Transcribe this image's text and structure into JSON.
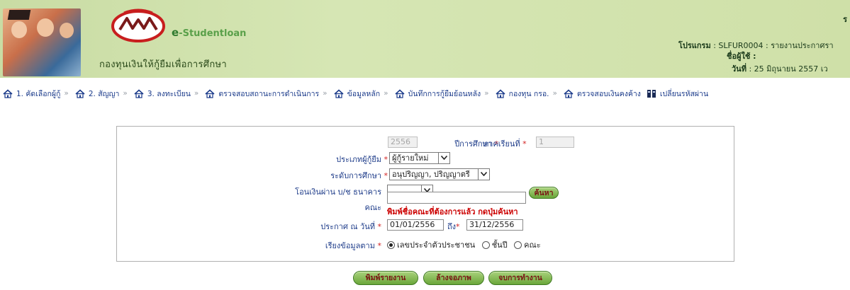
{
  "header": {
    "brand": "Studentloan",
    "brand_prefix": "e",
    "fund_name": "กองทุนเงินให้กู้ยืมเพื่อการศึกษา",
    "corner_text": "ร",
    "program_label": "โปรแกรม",
    "program_value": ": SLFUR0004 : รายงานประกาศรา",
    "user_label": "ชื่อผู้ใช้ :",
    "date_label": "วันที่",
    "date_value": ": 25 มิถุนายน 2557 เว"
  },
  "menu": {
    "items": [
      {
        "label": "1. คัดเลือกผู้กู้",
        "icon": "home-icon"
      },
      {
        "label": "2. สัญญา",
        "icon": "home-icon"
      },
      {
        "label": "3. ลงทะเบียน",
        "icon": "home-icon"
      },
      {
        "label": "ตรวจสอบสถานะการดำเนินการ",
        "icon": "home-icon"
      },
      {
        "label": "ข้อมูลหลัก",
        "icon": "home-icon"
      },
      {
        "label": "บันทึกการกู้ยืมย้อนหลัง",
        "icon": "home-icon"
      },
      {
        "label": "กองทุน กรอ.",
        "icon": "home-icon"
      },
      {
        "label": "ตรวจสอบเงินคงค้าง",
        "icon": "home-icon"
      },
      {
        "label": "เปลี่ยนรหัสผ่าน",
        "icon": "key-icon"
      }
    ],
    "separator": "»"
  },
  "form": {
    "academic_year": {
      "label": "ปีการศึกษา",
      "value": "2556"
    },
    "semester": {
      "label": "ภาคเรียนที่",
      "value": "1"
    },
    "borrower_type": {
      "label": "ประเภทผู้กู้ยืม",
      "value": "ผู้กู้รายใหม่"
    },
    "education_level": {
      "label": "ระดับการศึกษา",
      "value": "อนุปริญญา, ปริญญาตรี"
    },
    "bank_transfer": {
      "label": "โอนเงินผ่าน บ/ช ธนาคาร",
      "value": ""
    },
    "faculty": {
      "label": "คณะ",
      "value": "",
      "search_button": "ค้นหา",
      "hint": "พิมพ์ชื่อคณะที่ต้องการแล้ว กดปุ่มค้นหา"
    },
    "announce_date": {
      "label": "ประกาศ ณ วันที่",
      "from": "01/01/2556",
      "to_label": "ถึง",
      "to": "31/12/2556"
    },
    "sort": {
      "label": "เรียงข้อมูลตาม",
      "options": [
        "เลขประจำตัวประชาชน",
        "ชั้นปี",
        "คณะ"
      ],
      "selected": 0
    },
    "required_mark": "*"
  },
  "buttons": {
    "print": "พิมพ์รายงาน",
    "clear": "ล้างจอภาพ",
    "exit": "จบการทำงาน"
  },
  "colors": {
    "banner": "#cfe0a8",
    "label": "#1f3d8a",
    "required": "#d21f1f",
    "hint": "#cc0000",
    "button": "#6aa63a"
  }
}
